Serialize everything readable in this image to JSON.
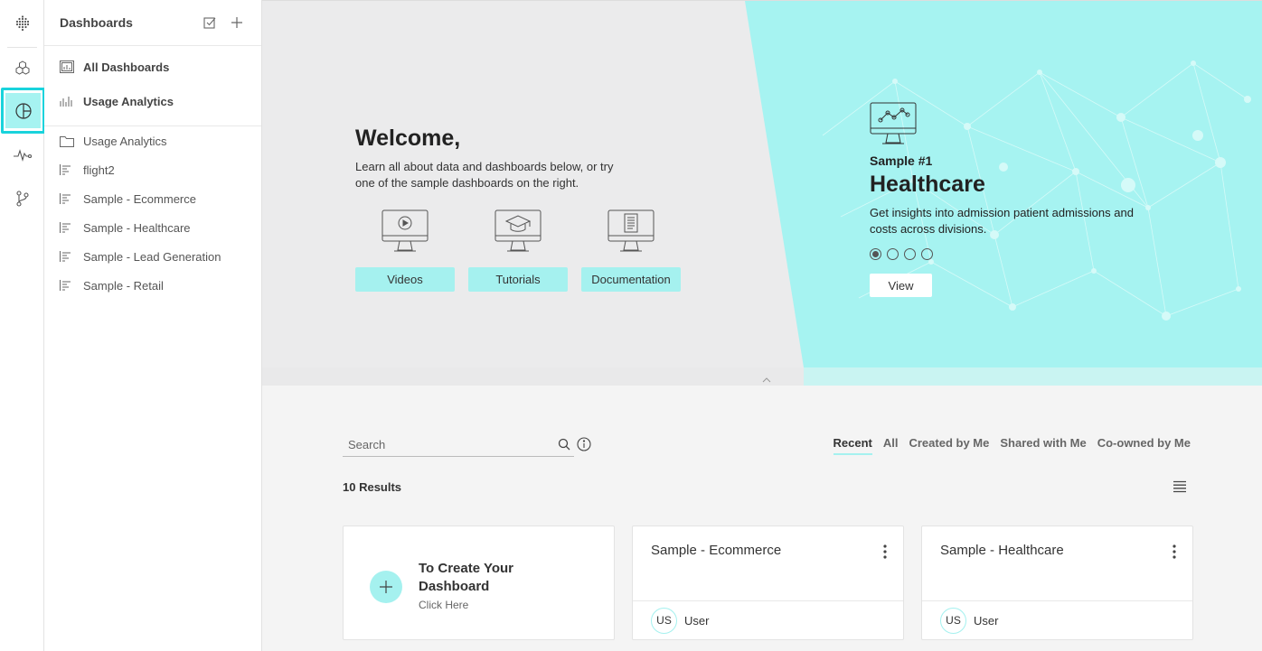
{
  "rail": {
    "items": [
      {
        "name": "grid-logo-icon"
      },
      {
        "name": "cubes-icon"
      },
      {
        "name": "dashboard-pie-icon",
        "active": true
      },
      {
        "name": "pulse-icon"
      },
      {
        "name": "branch-icon"
      }
    ],
    "accent": "#19d3dc"
  },
  "panel": {
    "title": "Dashboards",
    "pinned": [
      {
        "label": "All Dashboards",
        "icon": "dashboard-grid-icon"
      },
      {
        "label": "Usage Analytics",
        "icon": "bar-chart-icon"
      }
    ],
    "items": [
      {
        "label": "Usage Analytics",
        "icon": "folder-icon"
      },
      {
        "label": "flight2",
        "icon": "list-chart-icon"
      },
      {
        "label": "Sample - Ecommerce",
        "icon": "list-chart-icon"
      },
      {
        "label": "Sample - Healthcare",
        "icon": "list-chart-icon"
      },
      {
        "label": "Sample - Lead Generation",
        "icon": "list-chart-icon"
      },
      {
        "label": "Sample - Retail",
        "icon": "list-chart-icon"
      }
    ]
  },
  "hero": {
    "welcome": "Welcome,",
    "subtitle": "Learn all about data and dashboards below, or try one of the sample dashboards on the right.",
    "resources": [
      {
        "label": "Videos",
        "icon": "play-monitor-icon"
      },
      {
        "label": "Tutorials",
        "icon": "graduation-monitor-icon"
      },
      {
        "label": "Documentation",
        "icon": "document-monitor-icon"
      }
    ],
    "sample": {
      "number": "Sample #1",
      "title": "Healthcare",
      "description": "Get insights into admission patient admissions and costs across divisions.",
      "carousel_count": 4,
      "carousel_active": 1,
      "view_label": "View"
    },
    "colors": {
      "teal": "#a6f3f1",
      "accent_button": "#a5f1ef"
    }
  },
  "browser": {
    "search_placeholder": "Search",
    "filters": [
      {
        "label": "Recent",
        "active": true
      },
      {
        "label": "All"
      },
      {
        "label": "Created by Me"
      },
      {
        "label": "Shared with Me"
      },
      {
        "label": "Co-owned by Me"
      }
    ],
    "results": "10 Results",
    "create_card": {
      "title": "To Create Your Dashboard",
      "subtitle": "Click Here"
    },
    "cards": [
      {
        "title": "Sample - Ecommerce",
        "avatar": "US",
        "owner": "User"
      },
      {
        "title": "Sample - Healthcare",
        "avatar": "US",
        "owner": "User"
      }
    ]
  }
}
